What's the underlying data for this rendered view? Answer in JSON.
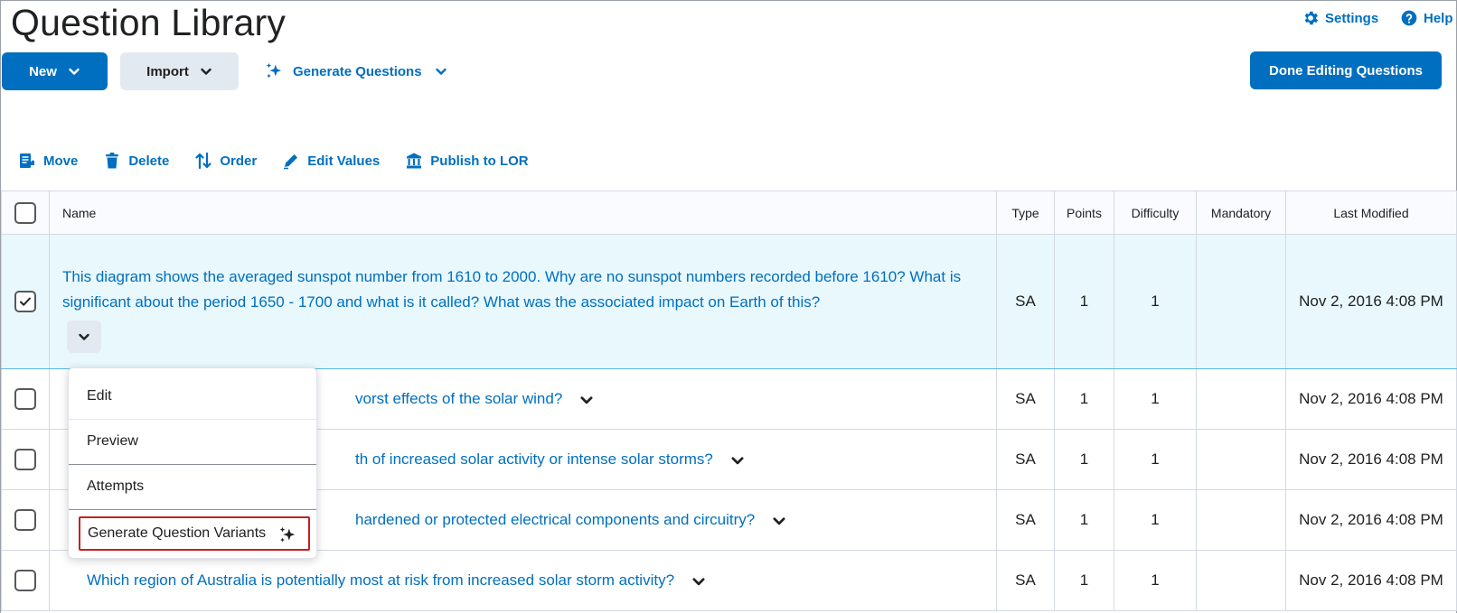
{
  "page": {
    "title": "Question Library"
  },
  "header_links": {
    "settings": "Settings",
    "help": "Help"
  },
  "toolbar": {
    "new_label": "New",
    "import_label": "Import",
    "generate_label": "Generate Questions",
    "done_label": "Done Editing Questions"
  },
  "actions": {
    "move": "Move",
    "delete": "Delete",
    "order": "Order",
    "edit_values": "Edit Values",
    "publish": "Publish to LOR"
  },
  "table": {
    "headers": {
      "name": "Name",
      "type": "Type",
      "points": "Points",
      "difficulty": "Difficulty",
      "mandatory": "Mandatory",
      "last_modified": "Last Modified"
    },
    "rows": [
      {
        "name_line1": "This diagram shows the averaged sunspot number from 1610 to 2000. Why are no sunspot numbers recorded before 1610? What is",
        "name_line2": "significant about the period 1650 - 1700 and what is it called? What was the associated impact on Earth of this?",
        "type": "SA",
        "points": "1",
        "difficulty": "1",
        "mandatory": "",
        "last_modified": "Nov 2, 2016 4:08 PM",
        "selected": true
      },
      {
        "name": "vorst effects of the solar wind?",
        "type": "SA",
        "points": "1",
        "difficulty": "1",
        "mandatory": "",
        "last_modified": "Nov 2, 2016 4:08 PM"
      },
      {
        "name": "th of increased solar activity or intense solar storms?",
        "type": "SA",
        "points": "1",
        "difficulty": "1",
        "mandatory": "",
        "last_modified": "Nov 2, 2016 4:08 PM"
      },
      {
        "name": "hardened or protected electrical components and circuitry?",
        "type": "SA",
        "points": "1",
        "difficulty": "1",
        "mandatory": "",
        "last_modified": "Nov 2, 2016 4:08 PM"
      },
      {
        "name": "Which region of Australia is potentially most at risk from increased solar storm activity?",
        "type": "SA",
        "points": "1",
        "difficulty": "1",
        "mandatory": "",
        "last_modified": "Nov 2, 2016 4:08 PM"
      }
    ]
  },
  "context_menu": {
    "items": [
      "Edit",
      "Preview",
      "Attempts",
      "Generate Question Variants"
    ]
  },
  "colors": {
    "accent": "#006fbf",
    "selected_row": "#e8f8fd",
    "highlight_border": "#c4201f"
  }
}
